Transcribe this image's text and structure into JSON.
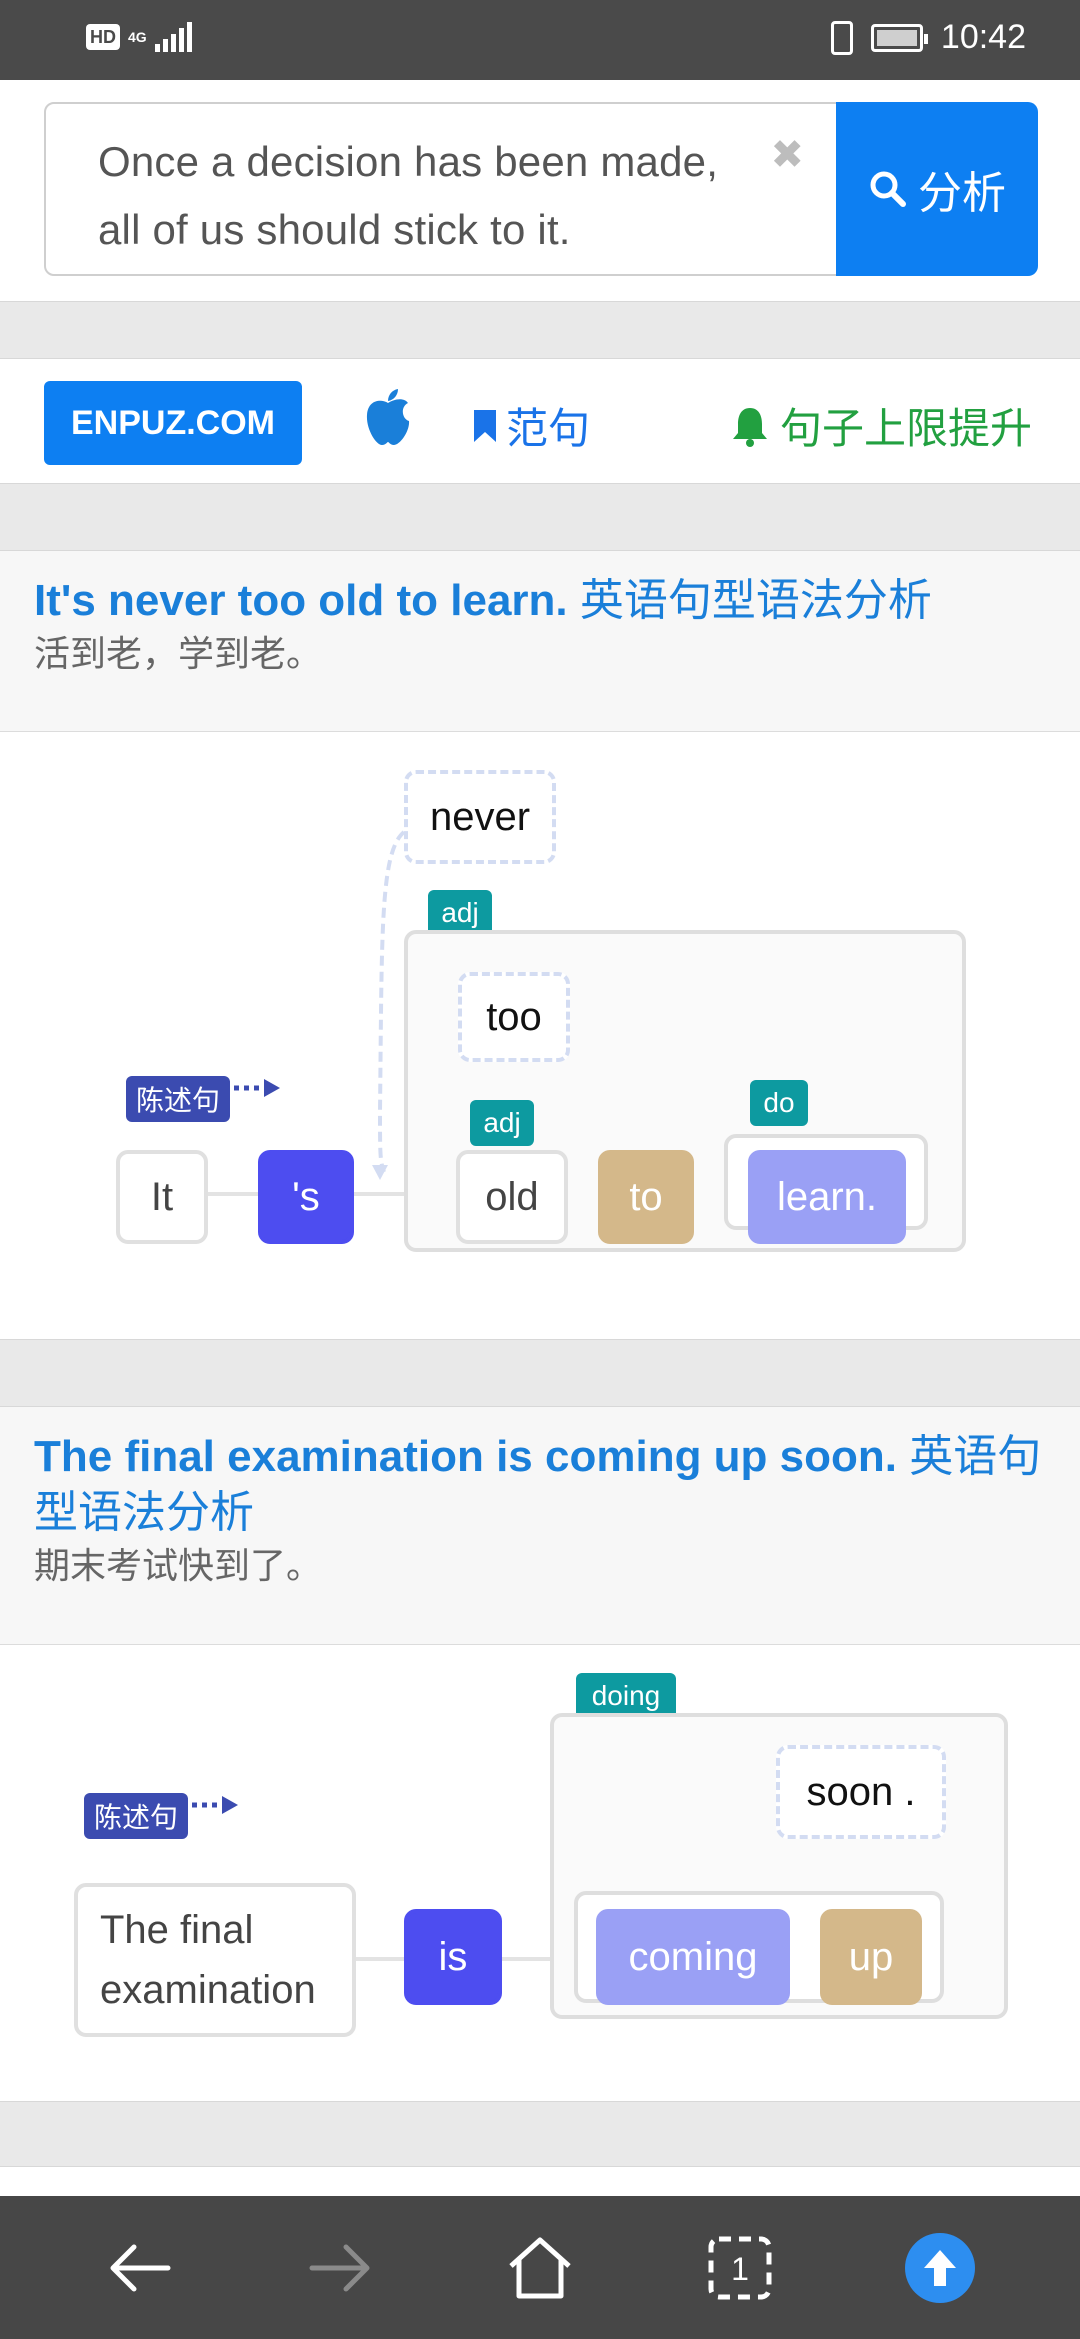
{
  "status_bar": {
    "hd": "HD",
    "network": "4G",
    "time": "10:42"
  },
  "search": {
    "query": "Once a decision has been made, all of us should stick to it.",
    "button_label": "分析"
  },
  "nav": {
    "brand": "ENPUZ.COM",
    "examples_label": "范句",
    "upgrade_label": "句子上限提升"
  },
  "cards": [
    {
      "title_en": "It's never too old to learn.",
      "title_cn": "英语句型语法分析",
      "translation": "活到老，学到老。",
      "sentence_type": "陈述句",
      "tokens": {
        "subject": "It",
        "verb": "'s",
        "adverb": "never",
        "adverb2": "too",
        "adj": "old",
        "to": "to",
        "verb2": "learn."
      },
      "labels": {
        "adj_outer": "adj",
        "adj_inner": "adj",
        "do": "do"
      }
    },
    {
      "title_en": "The final examination is coming up soon.",
      "title_cn": "英语句型语法分析",
      "translation": "期末考试快到了。",
      "sentence_type": "陈述句",
      "tokens": {
        "subject": "The final examination",
        "verb": "is",
        "adverb": "soon .",
        "doing": "coming",
        "particle": "up"
      },
      "labels": {
        "doing": "doing"
      }
    }
  ],
  "colors": {
    "primary": "#0d7ff2",
    "verb": "#4d4df0",
    "tan": "#d4b88a",
    "lilac": "#9aa0f5",
    "teal": "#0d9aa0",
    "navy": "#3b4bb0",
    "green": "#22a040"
  },
  "bottom_nav": [
    "back-icon",
    "forward-icon",
    "home-icon",
    "tabs-icon",
    "scroll-top-icon"
  ],
  "tab_count": "1"
}
